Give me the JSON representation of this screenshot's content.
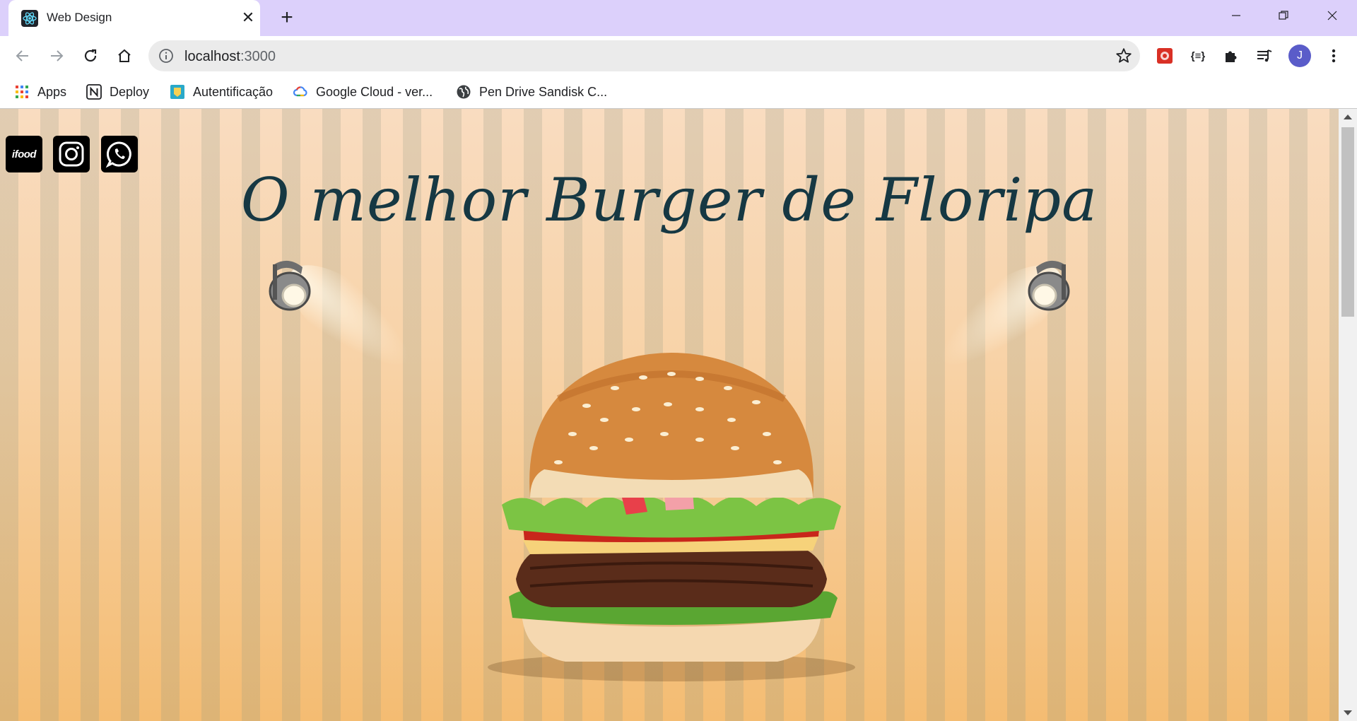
{
  "browser": {
    "tab": {
      "title": "Web Design",
      "favicon": "react-icon"
    },
    "new_tab_icon": "plus-icon",
    "window_controls": [
      "minimize-icon",
      "restore-icon",
      "close-icon"
    ],
    "nav": [
      "back-icon",
      "forward-icon",
      "reload-icon",
      "home-icon"
    ],
    "address": {
      "host": "localhost",
      "port": ":3000"
    },
    "extensions": [
      "red-extension-icon",
      "json-extension-icon",
      "puzzle-icon",
      "media-icon"
    ],
    "profile_initial": "J"
  },
  "bookmarks": [
    {
      "label": "Apps",
      "icon": "apps-grid-icon"
    },
    {
      "label": "Deploy",
      "icon": "notion-icon"
    },
    {
      "label": "Autentificação",
      "icon": "badge-icon"
    },
    {
      "label": "Google Cloud - ver...",
      "icon": "google-cloud-icon"
    },
    {
      "label": "Pen Drive Sandisk C...",
      "icon": "globe-icon"
    }
  ],
  "page": {
    "social": [
      {
        "name": "ifood",
        "label": "ifood"
      },
      {
        "name": "instagram"
      },
      {
        "name": "whatsapp"
      }
    ],
    "headline": "O melhor Burger de Floripa",
    "colors": {
      "headline": "#163843",
      "bg_top": "#f9dcc0",
      "bg_bottom": "#f4bc72"
    }
  }
}
